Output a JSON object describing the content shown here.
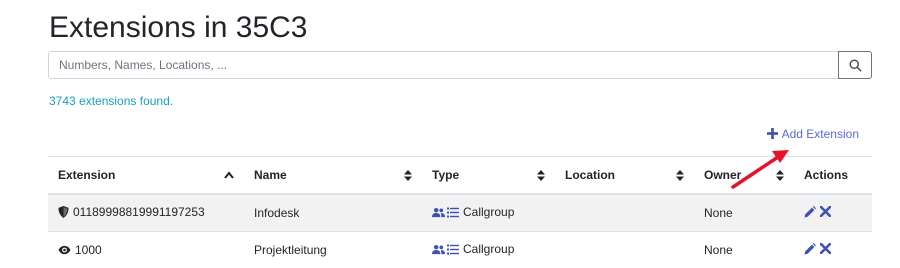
{
  "page": {
    "title": "Extensions in 35C3"
  },
  "search": {
    "placeholder": "Numbers, Names, Locations, ...",
    "value": ""
  },
  "results": {
    "count_text": "3743 extensions found."
  },
  "toolbar": {
    "add_label": "Add Extension"
  },
  "table": {
    "headers": {
      "extension": "Extension",
      "name": "Name",
      "type": "Type",
      "location": "Location",
      "owner": "Owner",
      "actions": "Actions"
    },
    "rows": [
      {
        "icon": "shield-icon",
        "extension": "0118999881999119725​3",
        "name": "Infodesk",
        "type_icon": "users-list-icon",
        "type": "Callgroup",
        "location": "",
        "owner": "None"
      },
      {
        "icon": "eye-icon",
        "extension": "1000",
        "name": "Projektleitung",
        "type_icon": "users-list-icon",
        "type": "Callgroup",
        "location": "",
        "owner": "None"
      }
    ]
  },
  "colors": {
    "accent": "#3f51b5",
    "link": "#17a2b8",
    "annotation_arrow": "#e8112d"
  }
}
